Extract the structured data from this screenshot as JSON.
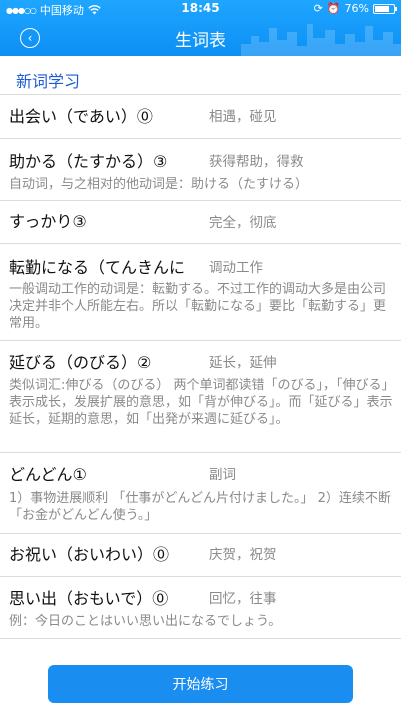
{
  "status": {
    "carrier": "中国移动",
    "time": "18:45",
    "battery": "76%",
    "battery_level": 0.76
  },
  "header": {
    "title": "生词表",
    "back_icon": "chevron-left-circle-icon"
  },
  "section_title": "新词学习",
  "words": [
    {
      "word": "出会い（であい）⓪",
      "meaning": "相遇，碰见",
      "note": ""
    },
    {
      "word": "助かる（たすかる）③",
      "meaning": "获得帮助，得救",
      "note": "自动词，与之相对的他动词是：助ける（たすける）"
    },
    {
      "word": "すっかり③",
      "meaning": "完全，彻底",
      "note": ""
    },
    {
      "word": "転勤になる（てんきんに",
      "meaning": "调动工作",
      "note": "一般调动工作的动词是：転勤する。不过工作的调动大多是由公司决定并非个人所能左右。所以「転勤になる」要比「転勤する」更常用。"
    },
    {
      "word": "延びる（のびる）②",
      "meaning": "延长，延伸",
      "note": "类似词汇:伸びる（のびる） 两个单词都读错「のびる」，「伸びる」表示成长，发展扩展的意思，如「背が伸びる」。而「延びる」表示延长，延期的意思，如「出発が来週に延びる」。"
    },
    {
      "word": "どんどん①",
      "meaning": "副词",
      "note": "1）事物进展顺利 「仕事がどんどん片付けました。」 2）连续不断「お金がどんどん使う。」"
    },
    {
      "word": "お祝い（おいわい）⓪",
      "meaning": "庆贺，祝贺",
      "note": ""
    },
    {
      "word": "思い出（おもいで）⓪",
      "meaning": "回忆，往事",
      "note": "例：今日のことはいい思い出になるでしょう。"
    }
  ],
  "start_button": "开始练习",
  "colors": {
    "header_blue": "#1fa6ff",
    "accent": "#1a8ef0",
    "section_title": "#1e5bd6",
    "note_gray": "#8a8a8a"
  }
}
